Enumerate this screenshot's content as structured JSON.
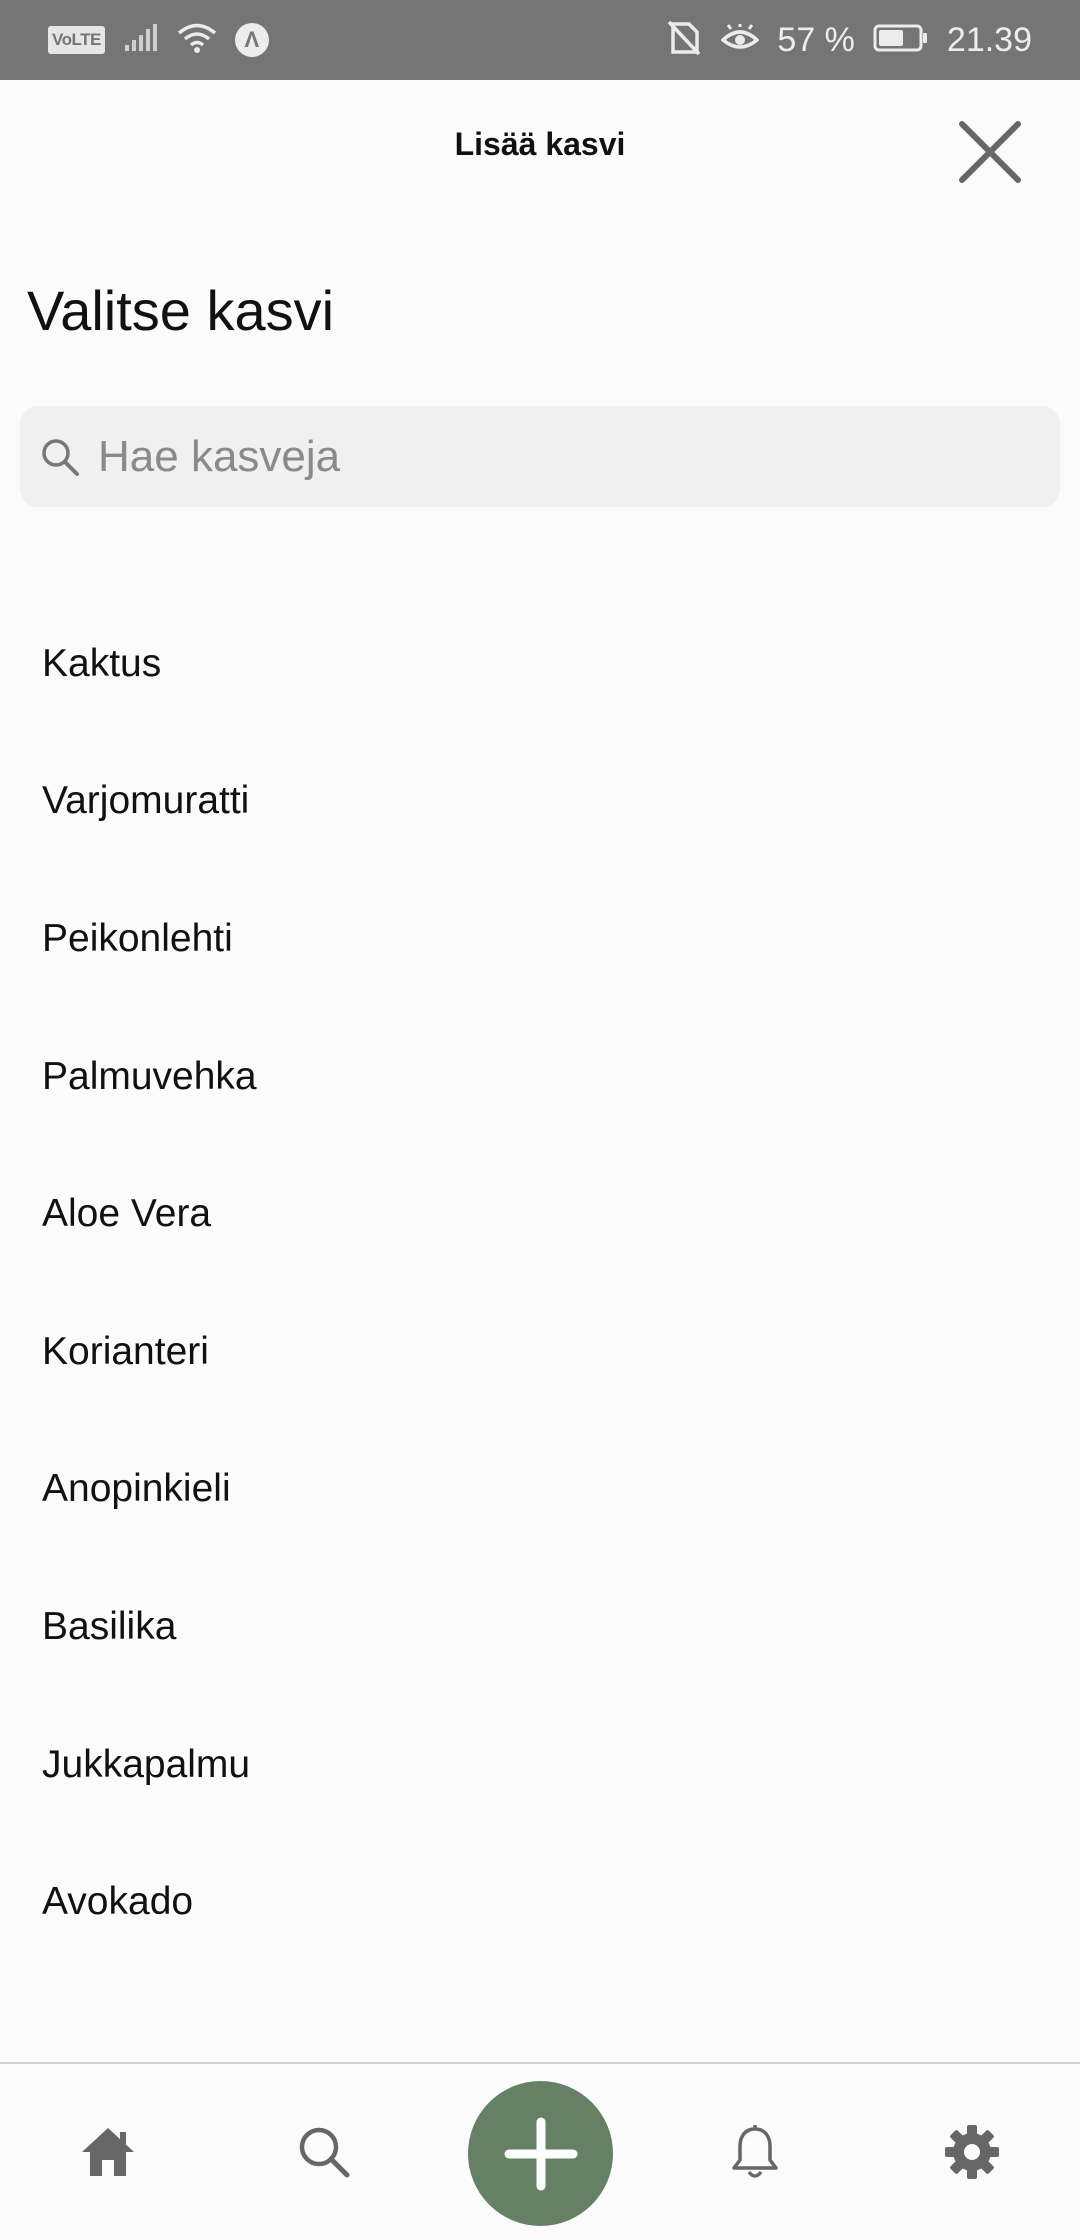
{
  "status_bar": {
    "volte": "VoLTE",
    "battery_percent": "57 %",
    "time": "21.39",
    "icons": [
      "signal-icon",
      "wifi-icon",
      "a-badge-icon",
      "no-sim-icon",
      "eye-icon",
      "battery-icon"
    ]
  },
  "header": {
    "title": "Lisää kasvi",
    "close_icon": "close-icon"
  },
  "page_title": "Valitse kasvi",
  "search": {
    "placeholder": "Hae kasveja",
    "value": ""
  },
  "plants": [
    {
      "label": "Kaktus"
    },
    {
      "label": "Varjomuratti"
    },
    {
      "label": "Peikonlehti"
    },
    {
      "label": "Palmuvehka"
    },
    {
      "label": "Aloe Vera"
    },
    {
      "label": "Korianteri"
    },
    {
      "label": "Anopinkieli"
    },
    {
      "label": "Basilika"
    },
    {
      "label": "Jukkapalmu"
    },
    {
      "label": "Avokado"
    }
  ],
  "bottom_nav": {
    "items": [
      "home-icon",
      "search-icon",
      "add-icon",
      "bell-icon",
      "gear-icon"
    ],
    "accent_color": "#668066"
  }
}
